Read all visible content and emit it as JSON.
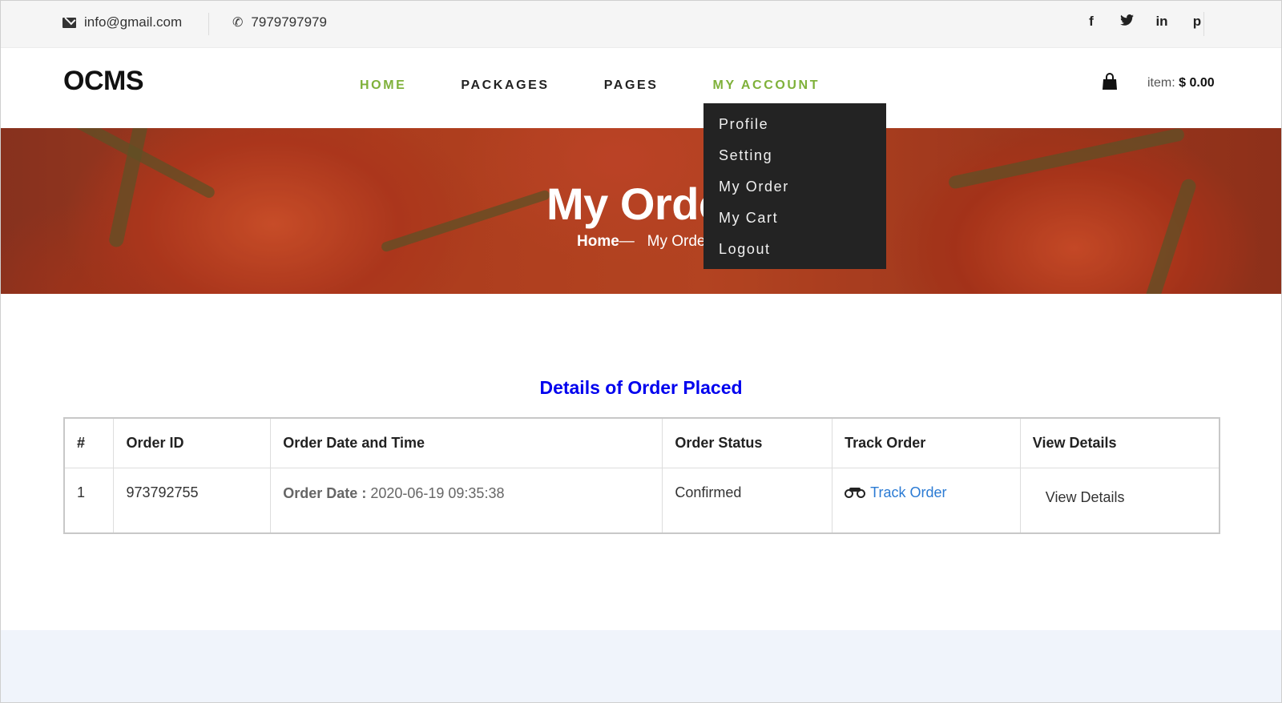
{
  "topbar": {
    "email": "info@gmail.com",
    "phone": "7979797979",
    "socials": [
      "f",
      "t",
      "in",
      "p"
    ],
    "social_icons": [
      "facebook-icon",
      "twitter-icon",
      "linkedin-icon",
      "pinterest-icon"
    ]
  },
  "header": {
    "logo": "OCMS",
    "nav": [
      "HOME",
      "PACKAGES",
      "PAGES",
      "MY ACCOUNT"
    ],
    "cart_label": "item:",
    "cart_amount": "$ 0.00"
  },
  "dropdown": {
    "items": [
      "Profile",
      "Setting",
      "My Order",
      "My Cart",
      "Logout"
    ]
  },
  "hero": {
    "title": "My Order",
    "breadcrumb_home": "Home",
    "breadcrumb_sep": "—",
    "breadcrumb_current": "My Order"
  },
  "section_title": "Details of Order Placed",
  "table": {
    "headers": [
      "#",
      "Order ID",
      "Order Date and Time",
      "Order Status",
      "Track Order",
      "View Details"
    ],
    "rows": [
      {
        "num": "1",
        "order_id": "973792755",
        "date_label": "Order Date :",
        "date_value": "2020-06-19 09:35:38",
        "status": "Confirmed",
        "track": "Track Order",
        "view": "View Details"
      }
    ]
  },
  "colors": {
    "accent_green": "#7fb13a",
    "title_blue": "#0000ee",
    "link_blue": "#2b7bd4",
    "dropdown_bg": "#232323"
  }
}
